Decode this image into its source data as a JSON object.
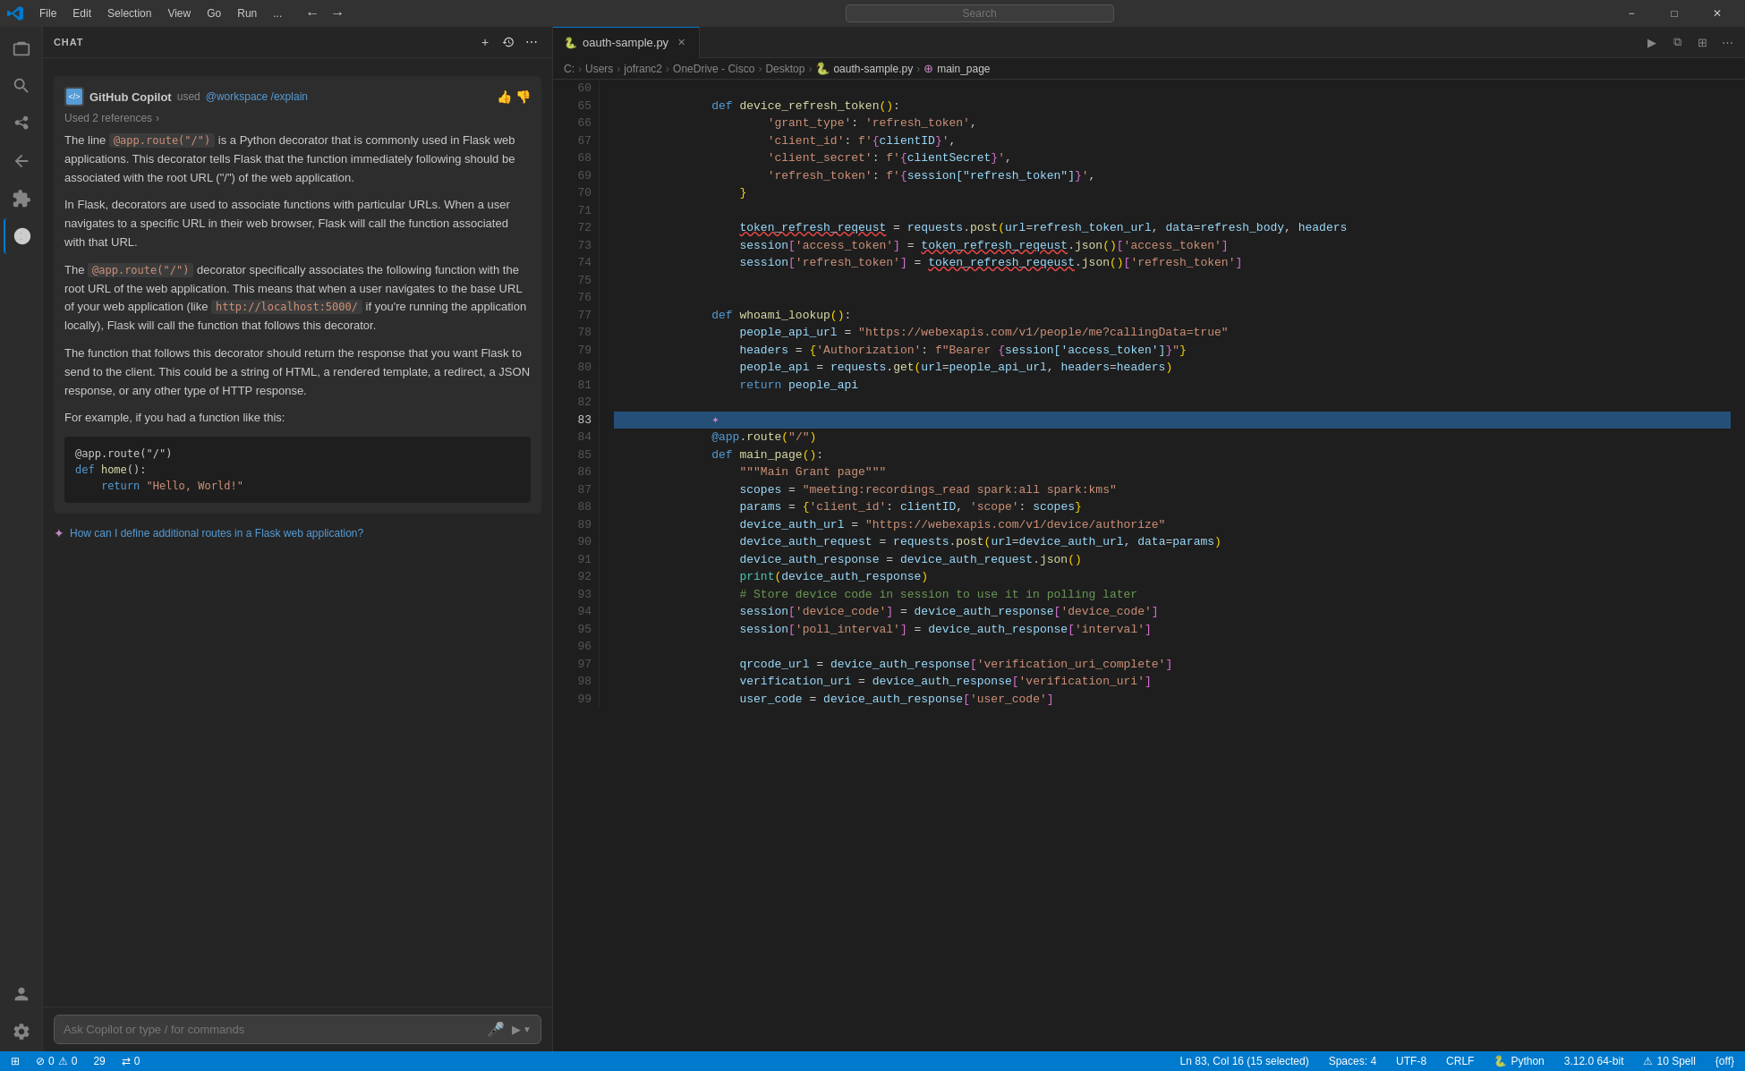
{
  "titlebar": {
    "menu_items": [
      "File",
      "Edit",
      "Selection",
      "View",
      "Go",
      "Run",
      "..."
    ],
    "search_placeholder": "Search",
    "nav_back": "←",
    "nav_forward": "→",
    "win_min": "−",
    "win_max": "□",
    "win_close": "✕"
  },
  "activity_bar": {
    "icons": [
      {
        "name": "explorer-icon",
        "symbol": "⎘",
        "active": false
      },
      {
        "name": "search-icon",
        "symbol": "🔍",
        "active": false
      },
      {
        "name": "source-control-icon",
        "symbol": "⑂",
        "active": false
      },
      {
        "name": "run-debug-icon",
        "symbol": "▷",
        "active": false
      },
      {
        "name": "extensions-icon",
        "symbol": "⊞",
        "active": false
      },
      {
        "name": "chat-icon",
        "symbol": "◉",
        "active": true
      },
      {
        "name": "test-icon",
        "symbol": "⚗",
        "active": false
      },
      {
        "name": "account-icon",
        "symbol": "◉",
        "active": false
      },
      {
        "name": "settings-icon",
        "symbol": "⚙",
        "active": false
      }
    ]
  },
  "sidebar": {
    "chat_header": "CHAT",
    "add_btn": "+",
    "history_btn": "🕐",
    "more_btn": "⋯",
    "message": {
      "copilot_label": "GitHub Copilot",
      "used_workspace": "used @workspace /explain",
      "used_refs": "Used 2 references",
      "chevron": "›",
      "paragraphs": [
        "The line @app.route(\"/\") is a Python decorator that is commonly used in Flask web applications. This decorator tells Flask that the function immediately following should be associated with the root URL (\"/\") of the web application.",
        "In Flask, decorators are used to associate functions with particular URLs. When a user navigates to a specific URL in their web browser, Flask will call the function associated with that URL.",
        "The @app.route(\"/\") decorator specifically associates the following function with the root URL of the web application. This means that when a user navigates to the base URL of your web application (like http://localhost:5000/ if you're running the application locally), Flask will call the function that follows this decorator.",
        "The function that follows this decorator should return the response that you want Flask to send to the client. This could be a string of HTML, a rendered template, a redirect, a JSON response, or any other type of HTTP response.",
        "For example, if you had a function like this:"
      ],
      "code_example": "@app.route(\"/\")\ndef home():\n    return \"Hello, World!\"",
      "thumb_up": "👍",
      "thumb_down": "👎"
    },
    "suggestion": "✦ How can I define additional routes in a Flask web application?",
    "input_placeholder": "Ask Copilot or type / for commands",
    "mic_symbol": "🎤",
    "send_symbol": "▶"
  },
  "editor": {
    "tab_filename": "oauth-sample.py",
    "tab_close": "✕",
    "run_btn": "▶",
    "split_btn": "⧉",
    "layout_btn": "⊞",
    "more_btn": "⋯",
    "breadcrumb": {
      "parts": [
        "C:",
        "Users",
        "jofranc2",
        "OneDrive - Cisco",
        "Desktop",
        "oauth-sample.py",
        "main_page"
      ],
      "separators": [
        ">",
        ">",
        ">",
        ">",
        ">",
        ">"
      ]
    },
    "lines": [
      {
        "num": 60,
        "content": "def device_refresh_token():"
      },
      {
        "num": 65,
        "content": "        'grant_type': 'refresh_token',"
      },
      {
        "num": 66,
        "content": "        'client_id': f'{clientID}',"
      },
      {
        "num": 67,
        "content": "        'client_secret': f'{clientSecret}',"
      },
      {
        "num": 68,
        "content": "        'refresh_token': f'{session[\"refresh_token\"]}',"
      },
      {
        "num": 69,
        "content": "    }"
      },
      {
        "num": 70,
        "content": ""
      },
      {
        "num": 71,
        "content": "    token_refresh_reqeust = requests.post(url=refresh_token_url, data=refresh_body, headers"
      },
      {
        "num": 72,
        "content": "    session['access_token'] = token_refresh_reqeust.json()['access_token']"
      },
      {
        "num": 73,
        "content": "    session['refresh_token'] = token_refresh_reqeust.json()['refresh_token']"
      },
      {
        "num": 74,
        "content": ""
      },
      {
        "num": 75,
        "content": ""
      },
      {
        "num": 76,
        "content": "def whoami_lookup():"
      },
      {
        "num": 77,
        "content": "    people_api_url = \"https://webexapis.com/v1/people/me?callingData=true\""
      },
      {
        "num": 78,
        "content": "    headers = {'Authorization': f\"Bearer {session['access_token']}\"}"
      },
      {
        "num": 79,
        "content": "    people_api = requests.get(url=people_api_url, headers=headers)"
      },
      {
        "num": 80,
        "content": "    return people_api"
      },
      {
        "num": 81,
        "content": ""
      },
      {
        "num": 82,
        "content": ""
      },
      {
        "num": 83,
        "content": "@app.route(\"/\")"
      },
      {
        "num": 84,
        "content": "def main_page():"
      },
      {
        "num": 85,
        "content": "    \"\"\"Main Grant page\"\"\""
      },
      {
        "num": 86,
        "content": "    scopes = \"meeting:recordings_read spark:all spark:kms\""
      },
      {
        "num": 87,
        "content": "    params = {'client_id': clientID, 'scope': scopes}"
      },
      {
        "num": 88,
        "content": "    device_auth_url = \"https://webexapis.com/v1/device/authorize\""
      },
      {
        "num": 89,
        "content": "    device_auth_request = requests.post(url=device_auth_url, data=params)"
      },
      {
        "num": 90,
        "content": "    device_auth_response = device_auth_request.json()"
      },
      {
        "num": 91,
        "content": "    print(device_auth_response)"
      },
      {
        "num": 92,
        "content": "    # Store device code in session to use it in polling later"
      },
      {
        "num": 93,
        "content": "    session['device_code'] = device_auth_response['device_code']"
      },
      {
        "num": 94,
        "content": "    session['poll_interval'] = device_auth_response['interval']"
      },
      {
        "num": 95,
        "content": ""
      },
      {
        "num": 96,
        "content": "    qrcode_url = device_auth_response['verification_uri_complete']"
      },
      {
        "num": 97,
        "content": "    verification_uri = device_auth_response['verification_uri']"
      },
      {
        "num": 98,
        "content": "    user_code = device_auth_response['user_code']"
      },
      {
        "num": 99,
        "content": ""
      }
    ]
  },
  "statusbar": {
    "remote": "⊞",
    "errors": "⊘ 0",
    "warnings": "⚠ 0",
    "problems": "29",
    "ports": "⇄ 0",
    "cursor": "Ln 83, Col 16 (15 selected)",
    "spaces": "Spaces: 4",
    "encoding": "UTF-8",
    "line_ending": "CRLF",
    "language": "🐍 Python",
    "version": "3.12.0 64-bit",
    "spell": "⚠ 10 Spell",
    "format": "{off}"
  }
}
